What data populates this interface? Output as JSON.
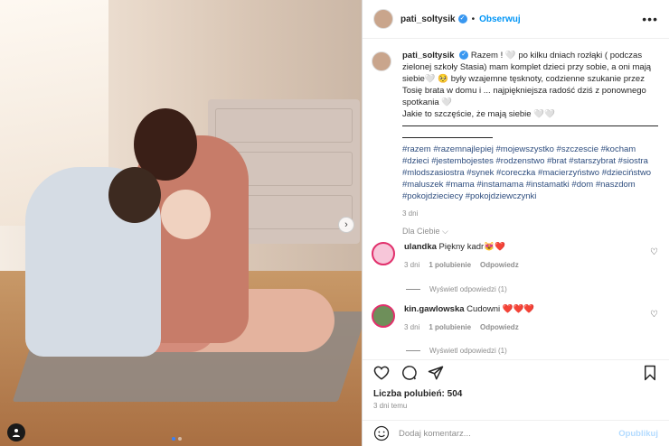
{
  "post": {
    "username": "pati_soltysik",
    "follow_label": "Obserwuj",
    "separator": "•",
    "more_label": "•••"
  },
  "photo": {
    "next_label": "›",
    "profile_icon": "person-icon"
  },
  "caption": {
    "username": "pati_soltysik",
    "text1": "Razem ! 🤍 po kilku dniach rozłąki ( podczas zielonej szkoły Stasia) mam komplet dzieci przy sobie, a oni mają siebie🤍 🥺 były wzajemne tęsknoty, codzienne szukanie przez Tosię brata w domu i ... najpiękniejsza radość dziś z ponownego spotkania 🤍",
    "text2": "Jakie to szczęście, że mają siebie 🤍🤍",
    "hashtags": "#razem #razemnajlepiej #mojewszystko #szczescie #kocham #dzieci #jestembojestes #rodzenstwo #brat #starszybrat #siostra #mlodszasiostra #synek #coreczka #macierzyństwo #dzieciństwo #maluszek #mama #instamama #instamatki #dom #naszdom #pokojdzieciecy #pokojdziewczynki",
    "time": "3 dni"
  },
  "for_you": "Dla Ciebie ⌵",
  "comments": [
    {
      "username": "ulandka",
      "text": "Piękny kadr😻❤️",
      "time": "3 dni",
      "likes": "1 polubienie",
      "reply": "Odpowiedz",
      "view_replies": "Wyświetl odpowiedzi (1)"
    },
    {
      "username": "kin.gawlowska",
      "text": "Cudowni ❤️❤️❤️",
      "time": "3 dni",
      "likes": "1 polubienie",
      "reply": "Odpowiedz",
      "view_replies": "Wyświetl odpowiedzi (1)"
    }
  ],
  "footer": {
    "likes": "Liczba polubień: 504",
    "ago": "3 dni temu",
    "comment_placeholder": "Dodaj komentarz...",
    "post_label": "Opublikuj"
  }
}
